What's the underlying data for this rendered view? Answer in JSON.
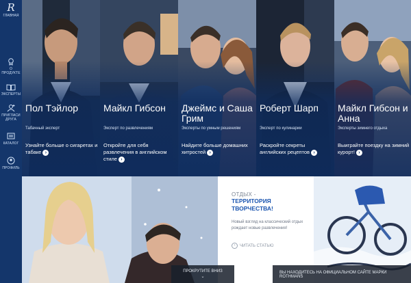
{
  "sidebar": {
    "logo_mark": "R",
    "items": [
      {
        "label": "ГЛАВНАЯ",
        "icon": "logo-icon"
      },
      {
        "label": "О ПРОДУКТЕ",
        "icon": "product-icon"
      },
      {
        "label": "ЭКСПЕРТЫ",
        "icon": "book-icon"
      },
      {
        "label": "ПРИГЛАСИ ДРУГА",
        "icon": "invite-icon"
      },
      {
        "label": "КАТАЛОГ",
        "icon": "catalog-icon"
      },
      {
        "label": "ПРОФИЛЬ",
        "icon": "profile-icon"
      }
    ]
  },
  "experts": [
    {
      "name": "Пол Тэйлор",
      "role": "Табачный эксперт",
      "cta": "Узнайте больше о сигаретах и табаке"
    },
    {
      "name": "Майкл Гибсон",
      "role": "Эксперт по развлечениям",
      "cta": "Откройте для себя развлечения в английском стиле"
    },
    {
      "name": "Джеймс и Саша Грим",
      "role": "Эксперты по умным решениям",
      "cta": "Найдите больше домашних хитростей"
    },
    {
      "name": "Роберт Шарп",
      "role": "Эксперт по кулинарии",
      "cta": "Раскройте секреты английских рецептов"
    },
    {
      "name": "Майкл Гибсон и Анна",
      "role": "Эксперты зимнего отдыха",
      "cta": "Выиграйте поездку на зимний курорт!"
    }
  ],
  "promo": {
    "kicker": "ОТДЫХ -",
    "headline_line1": "ТЕРРИТОРИЯ",
    "headline_line2": "ТВОРЧЕСТВА!",
    "description": "Новый взгляд на классический отдых рождает новые развлечения!",
    "read_more": "ЧИТАТЬ СТАТЬЮ"
  },
  "footer": {
    "scroll_down": "ПРОКРУТИТЕ ВНИЗ",
    "site_notice": "ВЫ НАХОДИТЕСЬ НА ОФИЦИАЛЬНОМ САЙТЕ МАРКИ ROTHMANS"
  },
  "colors": {
    "sidebar": "#14366b",
    "overlay": "#0e2c5e",
    "accent": "#1c56b0"
  }
}
